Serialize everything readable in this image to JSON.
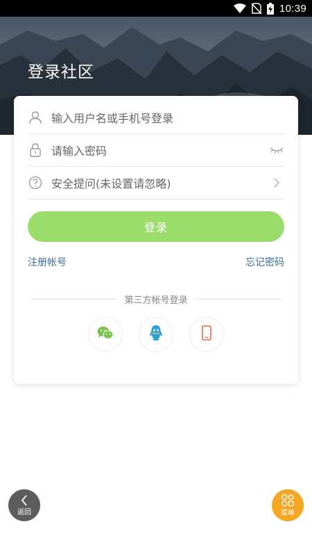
{
  "status_bar": {
    "time": "10:39",
    "icons": [
      "wifi-icon",
      "no-sim-icon",
      "battery-charging-icon"
    ]
  },
  "header": {
    "title": "登录社区"
  },
  "form": {
    "username_placeholder": "输入用户名或手机号登录",
    "password_placeholder": "请输入密码",
    "security_question": "安全提问(未设置请忽略)",
    "login_label": "登录"
  },
  "links": {
    "register": "注册帐号",
    "forgot_password": "忘记密码"
  },
  "third_party": {
    "title": "第三方帐号登录",
    "providers": [
      "wechat-icon",
      "qq-icon",
      "phone-icon"
    ]
  },
  "floating": {
    "back_label": "返回",
    "menu_label": "菜单"
  },
  "colors": {
    "accent": "#9bdc6b",
    "link": "#3b6ea5",
    "wechat": "#7bc44e",
    "qq": "#2a9fd8",
    "phone": "#f0604e",
    "menu_fab": "#f5a623",
    "back_fab": "#5d5d5d"
  }
}
